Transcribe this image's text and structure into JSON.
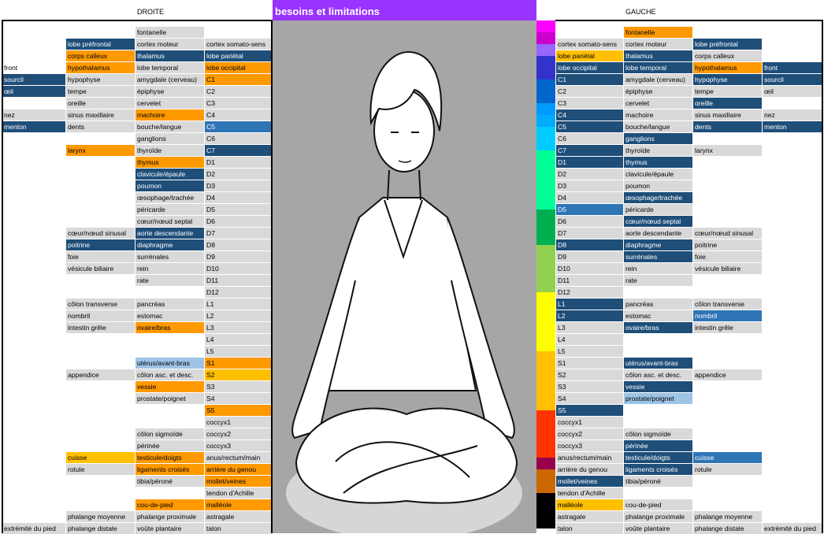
{
  "header": {
    "right_label": "DROITE",
    "left_label": "GAUCHE",
    "banner_title": "besoins et limitations"
  },
  "colors": {
    "grey": "#d9d9d9",
    "orange": "#ff9900",
    "gold": "#ffc000",
    "navy": "#1f4e79",
    "blue": "#2e75b6",
    "light_blue": "#9dc3e6",
    "banner": "#9933ff"
  },
  "left_table": [
    {
      "c1": "",
      "c2": "",
      "c3": "fontanelle",
      "c4": "",
      "s": [
        "",
        "",
        "g",
        ""
      ]
    },
    {
      "c1": "",
      "c2": "lobe préfrontal",
      "c3": "cortex moteur",
      "c4": "cortex somato-sens",
      "s": [
        "",
        "n",
        "g",
        "g"
      ]
    },
    {
      "c1": "",
      "c2": "corps calleux",
      "c3": "thalamus",
      "c4": "lobe pariétal",
      "s": [
        "",
        "o",
        "n",
        "n"
      ]
    },
    {
      "c1": "front",
      "c2": "hypothalamus",
      "c3": "lobe temporal",
      "c4": "lobe occipital",
      "s": [
        "",
        "o",
        "g",
        "o"
      ]
    },
    {
      "c1": "sourcil",
      "c2": "hypophyse",
      "c3": "amygdale (cerveau)",
      "c4": "C1",
      "s": [
        "n",
        "g",
        "g",
        "o"
      ]
    },
    {
      "c1": "œil",
      "c2": "tempe",
      "c3": "épiphyse",
      "c4": "C2",
      "s": [
        "n",
        "g",
        "g",
        "g"
      ]
    },
    {
      "c1": "",
      "c2": "oreille",
      "c3": "cervelet",
      "c4": "C3",
      "s": [
        "",
        "g",
        "g",
        "g"
      ]
    },
    {
      "c1": "nez",
      "c2": "sinus maxillaire",
      "c3": "machoire",
      "c4": "C4",
      "s": [
        "g",
        "g",
        "o",
        "g"
      ]
    },
    {
      "c1": "menton",
      "c2": "dents",
      "c3": "bouche/langue",
      "c4": "C5",
      "s": [
        "n",
        "g",
        "g",
        "m"
      ]
    },
    {
      "c1": "",
      "c2": "",
      "c3": "ganglions",
      "c4": "C6",
      "s": [
        "",
        "",
        "g",
        "g"
      ]
    },
    {
      "c1": "",
      "c2": "larynx",
      "c3": "thyroïde",
      "c4": "C7",
      "s": [
        "",
        "o",
        "g",
        "n"
      ]
    },
    {
      "c1": "",
      "c2": "",
      "c3": "thymus",
      "c4": "D1",
      "s": [
        "",
        "",
        "o",
        "g"
      ]
    },
    {
      "c1": "",
      "c2": "",
      "c3": "clavicule/épaule",
      "c4": "D2",
      "s": [
        "",
        "",
        "n",
        "g"
      ]
    },
    {
      "c1": "",
      "c2": "",
      "c3": "poumon",
      "c4": "D3",
      "s": [
        "",
        "",
        "n",
        "g"
      ]
    },
    {
      "c1": "",
      "c2": "",
      "c3": "œsophage/trachée",
      "c4": "D4",
      "s": [
        "",
        "",
        "g",
        "g"
      ]
    },
    {
      "c1": "",
      "c2": "",
      "c3": "péricarde",
      "c4": "D5",
      "s": [
        "",
        "",
        "g",
        "g"
      ]
    },
    {
      "c1": "",
      "c2": "",
      "c3": "cœur/nœud septal",
      "c4": "D6",
      "s": [
        "",
        "",
        "g",
        "g"
      ]
    },
    {
      "c1": "",
      "c2": "cœur/nœud sinusal",
      "c3": "aorte descendante",
      "c4": "D7",
      "s": [
        "",
        "g",
        "n",
        "g"
      ]
    },
    {
      "c1": "",
      "c2": "poitrine",
      "c3": "diaphragme",
      "c4": "D8",
      "s": [
        "",
        "n",
        "n",
        "g"
      ]
    },
    {
      "c1": "",
      "c2": "foie",
      "c3": "surrénales",
      "c4": "D9",
      "s": [
        "",
        "g",
        "g",
        "g"
      ]
    },
    {
      "c1": "",
      "c2": "vésicule biliaire",
      "c3": "rein",
      "c4": "D10",
      "s": [
        "",
        "g",
        "g",
        "g"
      ]
    },
    {
      "c1": "",
      "c2": "",
      "c3": "rate",
      "c4": "D11",
      "s": [
        "",
        "",
        "g",
        "g"
      ]
    },
    {
      "c1": "",
      "c2": "",
      "c3": "",
      "c4": "D12",
      "s": [
        "",
        "",
        "",
        "g"
      ]
    },
    {
      "c1": "",
      "c2": "côlon transverse",
      "c3": "pancréas",
      "c4": "L1",
      "s": [
        "",
        "g",
        "g",
        "g"
      ]
    },
    {
      "c1": "",
      "c2": "nombril",
      "c3": "estomac",
      "c4": "L2",
      "s": [
        "",
        "g",
        "g",
        "g"
      ]
    },
    {
      "c1": "",
      "c2": "intestin grêle",
      "c3": "ovaire/bras",
      "c4": "L3",
      "s": [
        "",
        "g",
        "o",
        "g"
      ]
    },
    {
      "c1": "",
      "c2": "",
      "c3": "",
      "c4": "L4",
      "s": [
        "",
        "",
        "",
        "g"
      ]
    },
    {
      "c1": "",
      "c2": "",
      "c3": "",
      "c4": "L5",
      "s": [
        "",
        "",
        "",
        "g"
      ]
    },
    {
      "c1": "",
      "c2": "",
      "c3": "utérus/avant-bras",
      "c4": "S1",
      "s": [
        "",
        "",
        "l",
        "o"
      ]
    },
    {
      "c1": "",
      "c2": "appendice",
      "c3": "côlon asc. et desc.",
      "c4": "S2",
      "s": [
        "",
        "g",
        "g",
        "y"
      ]
    },
    {
      "c1": "",
      "c2": "",
      "c3": "vessie",
      "c4": "S3",
      "s": [
        "",
        "",
        "o",
        "g"
      ]
    },
    {
      "c1": "",
      "c2": "",
      "c3": "prostate/poignet",
      "c4": "S4",
      "s": [
        "",
        "",
        "g",
        "g"
      ]
    },
    {
      "c1": "",
      "c2": "",
      "c3": "",
      "c4": "S5",
      "s": [
        "",
        "",
        "",
        "o"
      ]
    },
    {
      "c1": "",
      "c2": "",
      "c3": "",
      "c4": "coccyx1",
      "s": [
        "",
        "",
        "",
        "g"
      ]
    },
    {
      "c1": "",
      "c2": "",
      "c3": "côlon sigmoïde",
      "c4": "coccyx2",
      "s": [
        "",
        "",
        "g",
        "g"
      ]
    },
    {
      "c1": "",
      "c2": "",
      "c3": "périnée",
      "c4": "coccyx3",
      "s": [
        "",
        "",
        "g",
        "g"
      ]
    },
    {
      "c1": "",
      "c2": "cuisse",
      "c3": "testicule/doigts",
      "c4": "anus/rectum/main",
      "s": [
        "",
        "y",
        "o",
        "g"
      ]
    },
    {
      "c1": "",
      "c2": "rotule",
      "c3": "ligaments croisés",
      "c4": "arrière du genou",
      "s": [
        "",
        "g",
        "o",
        "o"
      ]
    },
    {
      "c1": "",
      "c2": "",
      "c3": "tibia/péroné",
      "c4": "mollet/veines",
      "s": [
        "",
        "",
        "g",
        "o"
      ]
    },
    {
      "c1": "",
      "c2": "",
      "c3": "",
      "c4": "tendon d'Achille",
      "s": [
        "",
        "",
        "",
        "g"
      ]
    },
    {
      "c1": "",
      "c2": "",
      "c3": "cou-de-pied",
      "c4": "malléole",
      "s": [
        "",
        "",
        "o",
        "o"
      ]
    },
    {
      "c1": "",
      "c2": "phalange moyenne",
      "c3": "phalange proximale",
      "c4": "astragale",
      "s": [
        "",
        "g",
        "g",
        "g"
      ]
    },
    {
      "c1": "extrémité du pied",
      "c2": "phalange distale",
      "c3": "voûte plantaire",
      "c4": "talon",
      "s": [
        "g",
        "g",
        "g",
        "g"
      ]
    }
  ],
  "right_table": [
    {
      "c1": "",
      "c2": "fontanelle",
      "c3": "",
      "c4": "",
      "s": [
        "",
        "o",
        "",
        ""
      ]
    },
    {
      "c1": "cortex somato-sens",
      "c2": "cortex moteur",
      "c3": "lobe préfrontal",
      "c4": "",
      "s": [
        "g",
        "g",
        "n",
        ""
      ]
    },
    {
      "c1": "lobe pariétal",
      "c2": "thalamus",
      "c3": "corps calleux",
      "c4": "",
      "s": [
        "y",
        "n",
        "g",
        ""
      ]
    },
    {
      "c1": "lobe occipital",
      "c2": "lobe temporal",
      "c3": "hypothalamus",
      "c4": "front",
      "s": [
        "n",
        "n",
        "o",
        "n"
      ]
    },
    {
      "c1": "C1",
      "c2": "amygdale (cerveau)",
      "c3": "hypophyse",
      "c4": "sourcil",
      "s": [
        "n",
        "g",
        "n",
        "n"
      ]
    },
    {
      "c1": "C2",
      "c2": "épiphyse",
      "c3": "tempe",
      "c4": "œil",
      "s": [
        "g",
        "g",
        "g",
        "g"
      ]
    },
    {
      "c1": "C3",
      "c2": "cervelet",
      "c3": "oreille",
      "c4": "",
      "s": [
        "g",
        "g",
        "n",
        ""
      ]
    },
    {
      "c1": "C4",
      "c2": "machoire",
      "c3": "sinus maxillaire",
      "c4": "nez",
      "s": [
        "n",
        "g",
        "g",
        "g"
      ]
    },
    {
      "c1": "C5",
      "c2": "bouche/langue",
      "c3": "dents",
      "c4": "menton",
      "s": [
        "n",
        "g",
        "n",
        "n"
      ]
    },
    {
      "c1": "C6",
      "c2": "ganglions",
      "c3": "",
      "c4": "",
      "s": [
        "g",
        "n",
        "",
        ""
      ]
    },
    {
      "c1": "C7",
      "c2": "thyroïde",
      "c3": "larynx",
      "c4": "",
      "s": [
        "n",
        "g",
        "g",
        ""
      ]
    },
    {
      "c1": "D1",
      "c2": "thymus",
      "c3": "",
      "c4": "",
      "s": [
        "n",
        "n",
        "",
        ""
      ]
    },
    {
      "c1": "D2",
      "c2": "clavicule/épaule",
      "c3": "",
      "c4": "",
      "s": [
        "g",
        "g",
        "",
        ""
      ]
    },
    {
      "c1": "D3",
      "c2": "poumon",
      "c3": "",
      "c4": "",
      "s": [
        "g",
        "g",
        "",
        ""
      ]
    },
    {
      "c1": "D4",
      "c2": "œsophage/trachée",
      "c3": "",
      "c4": "",
      "s": [
        "g",
        "n",
        "",
        ""
      ]
    },
    {
      "c1": "D5",
      "c2": "péricarde",
      "c3": "",
      "c4": "",
      "s": [
        "m",
        "g",
        "",
        ""
      ]
    },
    {
      "c1": "D6",
      "c2": "cœur/nœud septal",
      "c3": "",
      "c4": "",
      "s": [
        "g",
        "n",
        "",
        ""
      ]
    },
    {
      "c1": "D7",
      "c2": "aorte descendante",
      "c3": "cœur/nœud sinusal",
      "c4": "",
      "s": [
        "g",
        "g",
        "g",
        ""
      ]
    },
    {
      "c1": "D8",
      "c2": "diaphragme",
      "c3": "poitrine",
      "c4": "",
      "s": [
        "n",
        "n",
        "g",
        ""
      ]
    },
    {
      "c1": "D9",
      "c2": "surrénales",
      "c3": "foie",
      "c4": "",
      "s": [
        "g",
        "n",
        "g",
        ""
      ]
    },
    {
      "c1": "D10",
      "c2": "rein",
      "c3": "vésicule biliaire",
      "c4": "",
      "s": [
        "g",
        "g",
        "g",
        ""
      ]
    },
    {
      "c1": "D11",
      "c2": "rate",
      "c3": "",
      "c4": "",
      "s": [
        "g",
        "g",
        "",
        ""
      ]
    },
    {
      "c1": "D12",
      "c2": "",
      "c3": "",
      "c4": "",
      "s": [
        "g",
        "",
        "",
        ""
      ]
    },
    {
      "c1": "L1",
      "c2": "pancréas",
      "c3": "côlon transverse",
      "c4": "",
      "s": [
        "n",
        "g",
        "g",
        ""
      ]
    },
    {
      "c1": "L2",
      "c2": "estomac",
      "c3": "nombril",
      "c4": "",
      "s": [
        "n",
        "g",
        "m",
        ""
      ]
    },
    {
      "c1": "L3",
      "c2": "ovaire/bras",
      "c3": "intestin grêle",
      "c4": "",
      "s": [
        "g",
        "n",
        "g",
        ""
      ]
    },
    {
      "c1": "L4",
      "c2": "",
      "c3": "",
      "c4": "",
      "s": [
        "g",
        "",
        "",
        ""
      ]
    },
    {
      "c1": "L5",
      "c2": "",
      "c3": "",
      "c4": "",
      "s": [
        "g",
        "",
        "",
        ""
      ]
    },
    {
      "c1": "S1",
      "c2": "utérus/avant-bras",
      "c3": "",
      "c4": "",
      "s": [
        "g",
        "n",
        "",
        ""
      ]
    },
    {
      "c1": "S2",
      "c2": "côlon asc. et desc.",
      "c3": "appendice",
      "c4": "",
      "s": [
        "g",
        "g",
        "g",
        ""
      ]
    },
    {
      "c1": "S3",
      "c2": "vessie",
      "c3": "",
      "c4": "",
      "s": [
        "g",
        "n",
        "",
        ""
      ]
    },
    {
      "c1": "S4",
      "c2": "prostate/poignet",
      "c3": "",
      "c4": "",
      "s": [
        "g",
        "l",
        "",
        ""
      ]
    },
    {
      "c1": "S5",
      "c2": "",
      "c3": "",
      "c4": "",
      "s": [
        "n",
        "",
        "",
        ""
      ]
    },
    {
      "c1": "coccyx1",
      "c2": "",
      "c3": "",
      "c4": "",
      "s": [
        "g",
        "",
        "",
        ""
      ]
    },
    {
      "c1": "coccyx2",
      "c2": "côlon sigmoïde",
      "c3": "",
      "c4": "",
      "s": [
        "g",
        "g",
        "",
        ""
      ]
    },
    {
      "c1": "coccyx3",
      "c2": "périnée",
      "c3": "",
      "c4": "",
      "s": [
        "g",
        "n",
        "",
        ""
      ]
    },
    {
      "c1": "anus/rectum/main",
      "c2": "testicule/doigts",
      "c3": "cuisse",
      "c4": "",
      "s": [
        "g",
        "n",
        "m",
        ""
      ]
    },
    {
      "c1": "arrière du genou",
      "c2": "ligaments croisés",
      "c3": "rotule",
      "c4": "",
      "s": [
        "g",
        "n",
        "g",
        ""
      ]
    },
    {
      "c1": "mollet/veines",
      "c2": "tibia/péroné",
      "c3": "",
      "c4": "",
      "s": [
        "n",
        "g",
        "",
        ""
      ]
    },
    {
      "c1": "tendon d'Achille",
      "c2": "",
      "c3": "",
      "c4": "",
      "s": [
        "g",
        "",
        "",
        ""
      ]
    },
    {
      "c1": "malléole",
      "c2": "cou-de-pied",
      "c3": "",
      "c4": "",
      "s": [
        "y",
        "g",
        "",
        ""
      ]
    },
    {
      "c1": "astragale",
      "c2": "phalange proximale",
      "c3": "phalange moyenne",
      "c4": "",
      "s": [
        "g",
        "g",
        "g",
        ""
      ]
    },
    {
      "c1": "talon",
      "c2": "voûte plantaire",
      "c3": "phalange distale",
      "c4": "extrémité du pied",
      "s": [
        "g",
        "g",
        "g",
        "g"
      ]
    }
  ],
  "swatch_colors": [
    "#ff00ff",
    "#cc00cc",
    "#9966ff",
    "#3333cc",
    "#3333cc",
    "#0066cc",
    "#0066cc",
    "#0099ff",
    "#00aaff",
    "#00ccff",
    "#00ccff",
    "#00ff99",
    "#00ff99",
    "#00ff99",
    "#00ff99",
    "#00ff99",
    "#00b050",
    "#00b050",
    "#00b050",
    "#92d050",
    "#92d050",
    "#92d050",
    "#92d050",
    "#ffff00",
    "#ffff00",
    "#ffff00",
    "#ffff00",
    "#ffff00",
    "#ffc000",
    "#ffc000",
    "#ffc000",
    "#ffc000",
    "#ffc000",
    "#ff3300",
    "#ff3300",
    "#ff3300",
    "#ff3300",
    "#99004c",
    "#cc6600",
    "#cc6600",
    "#000000",
    "#000000",
    "#000000"
  ]
}
